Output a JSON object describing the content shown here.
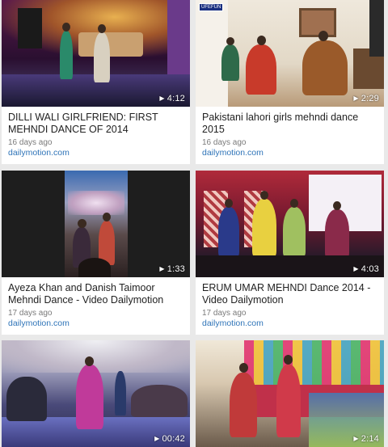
{
  "videos": [
    {
      "title": "DILLI WALI GIRLFRIEND: FIRST MEHNDI DANCE OF 2014",
      "duration": "4:12",
      "ago": "16 days ago",
      "source": "dailymotion.com"
    },
    {
      "title": "Pakistani lahori girls mehndi dance 2015",
      "duration": "2:29",
      "ago": "16 days ago",
      "source": "dailymotion.com",
      "badge": "UFEFUN"
    },
    {
      "title": "Ayeza Khan and Danish Taimoor Mehndi Dance - Video Dailymotion",
      "duration": "1:33",
      "ago": "17 days ago",
      "source": "dailymotion.com"
    },
    {
      "title": "ERUM UMAR MEHNDI Dance 2014 - Video Dailymotion",
      "duration": "4:03",
      "ago": "17 days ago",
      "source": "dailymotion.com"
    },
    {
      "title": "",
      "duration": "00:42",
      "ago": "",
      "source": ""
    },
    {
      "title": "",
      "duration": "2:14",
      "ago": "",
      "source": ""
    }
  ],
  "icons": {
    "play": "play-icon"
  }
}
